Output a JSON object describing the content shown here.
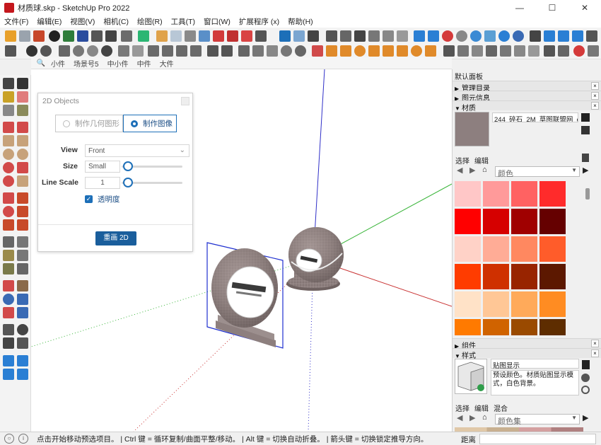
{
  "window": {
    "title": "材质球.skp - SketchUp Pro 2022",
    "minimize": "—",
    "maximize": "☐",
    "close": "✕"
  },
  "menu": [
    "文件(F)",
    "编辑(E)",
    "视图(V)",
    "相机(C)",
    "绘图(R)",
    "工具(T)",
    "窗口(W)",
    "扩展程序 (x)",
    "帮助(H)"
  ],
  "scenes": {
    "search_icon": "🔍",
    "tabs": [
      "小件",
      "场景号5",
      "中小件",
      "中件",
      "大件"
    ]
  },
  "panel2d": {
    "title": "2D Objects",
    "option_geometry": "制作几何图形",
    "option_image": "制作图像",
    "view_label": "View",
    "view_value": "Front",
    "size_label": "Size",
    "size_value": "Small",
    "line_scale_label": "Line Scale",
    "line_scale_value": "1",
    "transparency_label": "透明度",
    "redraw_button": "重画 2D"
  },
  "right_panel": {
    "header": "默认面板",
    "sections": {
      "outliner": "管理目录",
      "entity_info": "图元信息",
      "materials": "材质",
      "components": "组件",
      "styles": "样式"
    },
    "material_name": "244_碎石_2M_草图联盟网_cnwh",
    "tabs_select": "选择",
    "tabs_edit": "编辑",
    "tabs_mix": "混合",
    "material_collection": "颜色",
    "style_collection": "颜色集",
    "style_name": "贴图显示",
    "style_desc": "预设颜色。材质贴图显示模式，白色背景。"
  },
  "status": {
    "text": "点击开始移动预选项目。 | Ctrl 键 = 循环复制/曲面平整/移动。 | Alt 键 = 切换自动折叠。 | 箭头键 = 切换锁定推导方向。",
    "measure_label": "距离"
  },
  "colors": {
    "swatches": [
      "#ffc7c7",
      "#ff9a9a",
      "#ff6262",
      "#ff2b2b",
      "#ff0000",
      "#d60000",
      "#a00000",
      "#650000",
      "#ffd2c7",
      "#ffac96",
      "#ff8860",
      "#ff5c2a",
      "#ff3c00",
      "#cf3000",
      "#982400",
      "#5c1800",
      "#ffe2c7",
      "#ffc796",
      "#ffaa5a",
      "#ff8c22",
      "#ff7a00",
      "#d06300",
      "#9a4a00",
      "#5e2d00"
    ]
  }
}
